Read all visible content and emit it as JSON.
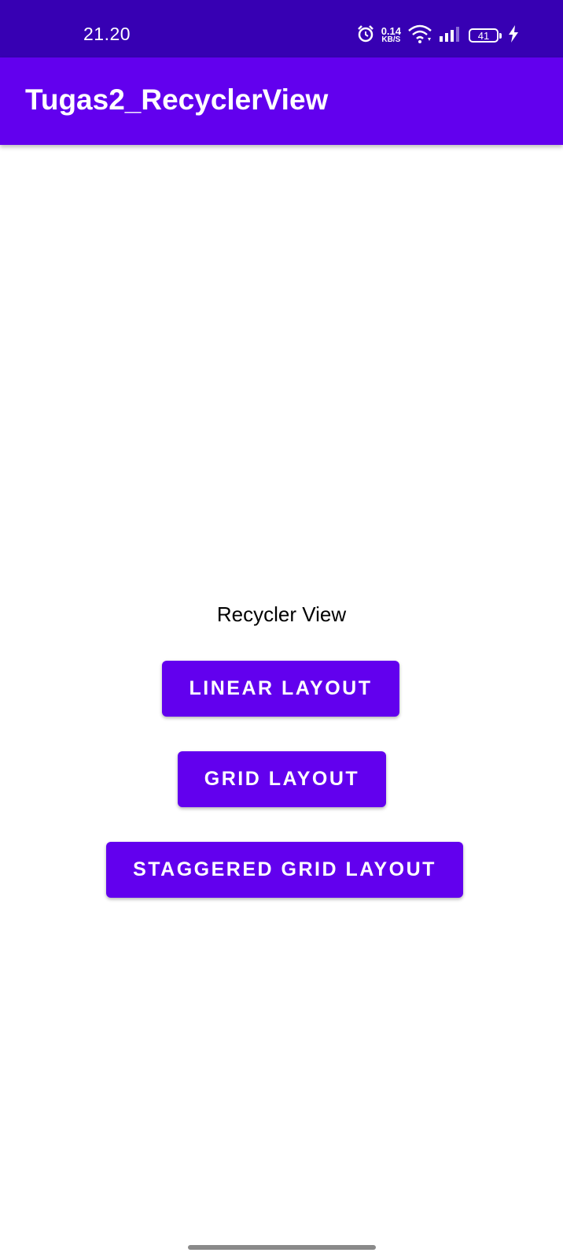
{
  "status_bar": {
    "time": "21.20",
    "net_speed_value": "0.14",
    "net_speed_unit": "KB/S",
    "battery_level": "41",
    "icons": [
      "alarm-icon",
      "wifi-icon",
      "signal-icon",
      "battery-icon",
      "charging-icon"
    ]
  },
  "app_bar": {
    "title": "Tugas2_RecyclerView"
  },
  "main": {
    "label": "Recycler View",
    "buttons": {
      "linear": "LINEAR LAYOUT",
      "grid": "GRID LAYOUT",
      "staggered": "STAGGERED GRID LAYOUT"
    }
  },
  "colors": {
    "status_bar": "#3700b3",
    "primary": "#6200ee",
    "on_primary": "#ffffff"
  }
}
